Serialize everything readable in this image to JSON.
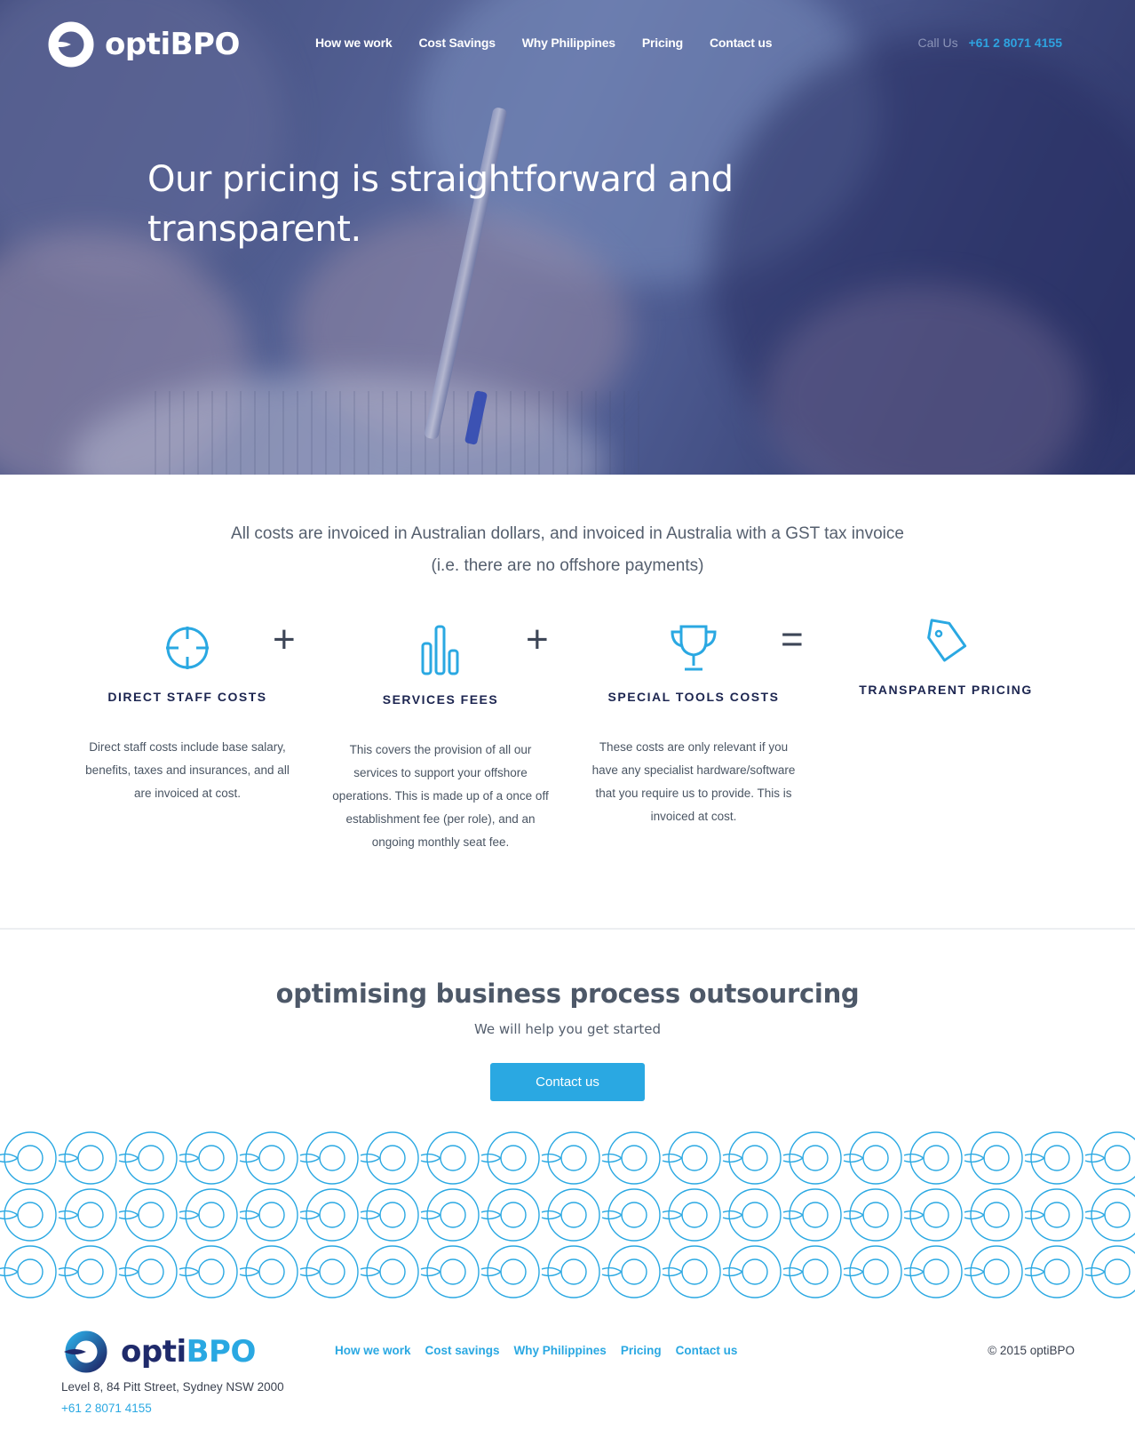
{
  "header": {
    "brand": "optiBPO",
    "nav": [
      "How we work",
      "Cost Savings",
      "Why Philippines",
      "Pricing",
      "Contact us"
    ],
    "call_label": "Call Us",
    "phone": "+61 2 8071 4155"
  },
  "hero": {
    "title": "Our pricing is straightforward and transparent."
  },
  "intro": {
    "text": "All costs are invoiced in Australian dollars, and invoiced in Australia with a GST tax invoice (i.e. there are no offshore payments)"
  },
  "pricing": {
    "operators": [
      "+",
      "+",
      "="
    ],
    "items": [
      {
        "icon": "crosshair-icon",
        "title": "DIRECT STAFF COSTS",
        "description": "Direct staff costs include base salary, benefits, taxes and insurances, and all are invoiced at cost."
      },
      {
        "icon": "bar-chart-icon",
        "title": "SERVICES FEES",
        "description": "This covers the provision of all our services to support your offshore operations. This is made up of a once off establishment fee (per role), and an ongoing monthly seat fee."
      },
      {
        "icon": "trophy-icon",
        "title": "SPECIAL TOOLS COSTS",
        "description": "These costs are only relevant if you have any specialist hardware/software that you require us to provide. This is invoiced at cost."
      },
      {
        "icon": "tag-icon",
        "title": "TRANSPARENT PRICING",
        "description": ""
      }
    ]
  },
  "cta": {
    "title": "optimising business process outsourcing",
    "subtitle": "We will help you get started",
    "button": "Contact us"
  },
  "footer": {
    "brand_a": "opti",
    "brand_b": "BPO",
    "address": "Level 8, 84 Pitt Street, Sydney NSW 2000",
    "phone": "+61 2 8071 4155",
    "nav": [
      "How we work",
      "Cost savings",
      "Why Philippines",
      "Pricing",
      "Contact us"
    ],
    "copyright": "© 2015 optiBPO"
  },
  "colors": {
    "accent": "#2aa8e2",
    "navy": "#1f2a6b",
    "text": "#4a5563"
  }
}
